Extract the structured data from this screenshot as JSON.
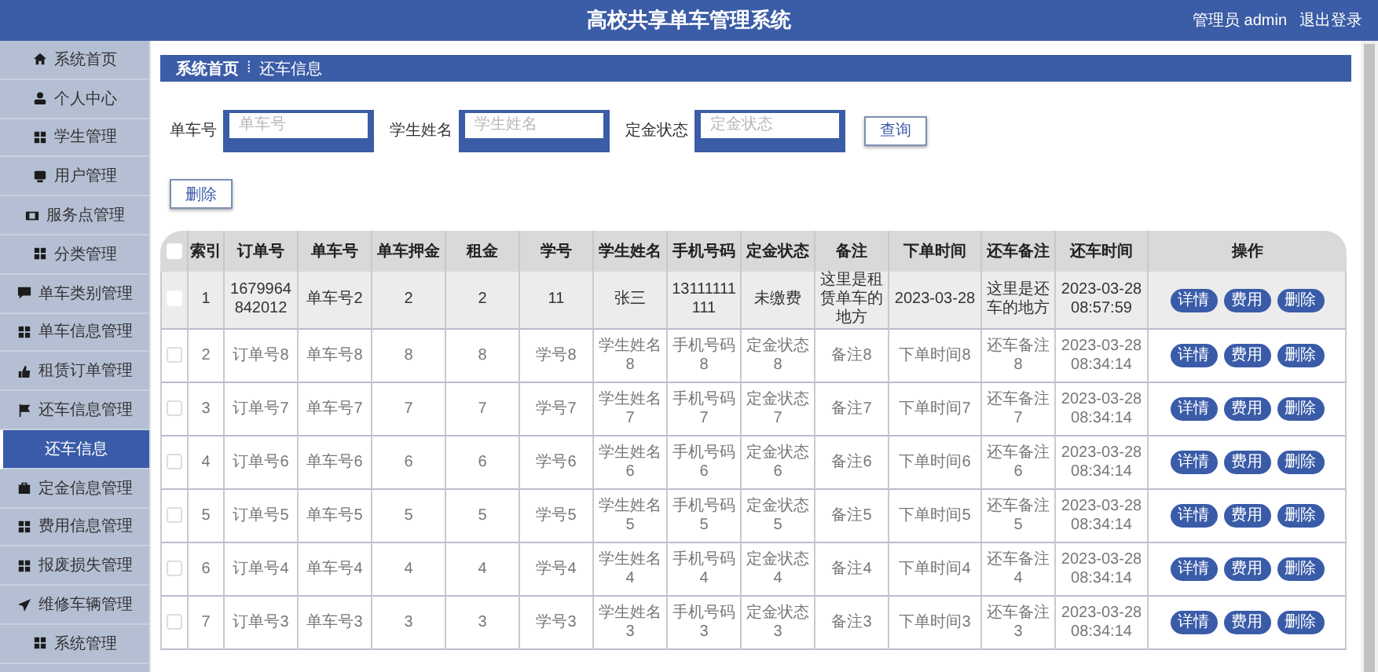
{
  "header": {
    "title": "高校共享单车管理系统",
    "user": "管理员 admin",
    "logout": "退出登录"
  },
  "sidebar": {
    "items": [
      {
        "label": "系统首页",
        "kind": "home",
        "selected": false
      },
      {
        "label": "个人中心",
        "kind": "user",
        "selected": false
      },
      {
        "label": "学生管理",
        "kind": "grid",
        "selected": false
      },
      {
        "label": "用户管理",
        "kind": "monitor",
        "selected": false
      },
      {
        "label": "服务点管理",
        "kind": "film",
        "selected": false
      },
      {
        "label": "分类管理",
        "kind": "grid",
        "selected": false
      },
      {
        "label": "单车类别管理",
        "kind": "chat",
        "selected": false
      },
      {
        "label": "单车信息管理",
        "kind": "grid",
        "selected": false
      },
      {
        "label": "租赁订单管理",
        "kind": "thumb",
        "selected": false
      },
      {
        "label": "还车信息管理",
        "kind": "flag",
        "selected": false
      },
      {
        "label": "还车信息",
        "kind": "sub",
        "selected": true
      },
      {
        "label": "定金信息管理",
        "kind": "bag",
        "selected": false
      },
      {
        "label": "费用信息管理",
        "kind": "grid",
        "selected": false
      },
      {
        "label": "报废损失管理",
        "kind": "grid",
        "selected": false
      },
      {
        "label": "维修车辆管理",
        "kind": "plane",
        "selected": false
      },
      {
        "label": "系统管理",
        "kind": "grid",
        "selected": false
      }
    ]
  },
  "breadcrumb": {
    "home": "系统首页",
    "separator": "⁞",
    "current": "还车信息"
  },
  "search": {
    "fields": [
      {
        "label": "单车号",
        "placeholder": "单车号"
      },
      {
        "label": "学生姓名",
        "placeholder": "学生姓名"
      },
      {
        "label": "定金状态",
        "placeholder": "定金状态"
      }
    ],
    "button": "查询"
  },
  "delete_button": "删除",
  "table": {
    "select_all_checked": false,
    "columns": [
      "索引",
      "订单号",
      "单车号",
      "单车押金",
      "租金",
      "学号",
      "学生姓名",
      "手机号码",
      "定金状态",
      "备注",
      "下单时间",
      "还车备注",
      "还车时间",
      "操作"
    ],
    "rows": [
      {
        "checked": false,
        "highlighted": true,
        "cells": [
          "1",
          "1679964842012",
          "单车号2",
          "2",
          "2",
          "11",
          "张三",
          "13111111111",
          "未缴费",
          "这里是租赁单车的地方",
          "2023-03-28",
          "这里是还车的地方",
          "2023-03-28 08:57:59"
        ],
        "actions": [
          "详情",
          "费用",
          "删除"
        ]
      },
      {
        "checked": false,
        "highlighted": false,
        "cells": [
          "2",
          "订单号8",
          "单车号8",
          "8",
          "8",
          "学号8",
          "学生姓名8",
          "手机号码8",
          "定金状态8",
          "备注8",
          "下单时间8",
          "还车备注8",
          "2023-03-28 08:34:14"
        ],
        "actions": [
          "详情",
          "费用",
          "删除"
        ]
      },
      {
        "checked": false,
        "highlighted": false,
        "cells": [
          "3",
          "订单号7",
          "单车号7",
          "7",
          "7",
          "学号7",
          "学生姓名7",
          "手机号码7",
          "定金状态7",
          "备注7",
          "下单时间7",
          "还车备注7",
          "2023-03-28 08:34:14"
        ],
        "actions": [
          "详情",
          "费用",
          "删除"
        ]
      },
      {
        "checked": false,
        "highlighted": false,
        "cells": [
          "4",
          "订单号6",
          "单车号6",
          "6",
          "6",
          "学号6",
          "学生姓名6",
          "手机号码6",
          "定金状态6",
          "备注6",
          "下单时间6",
          "还车备注6",
          "2023-03-28 08:34:14"
        ],
        "actions": [
          "详情",
          "费用",
          "删除"
        ]
      },
      {
        "checked": false,
        "highlighted": false,
        "cells": [
          "5",
          "订单号5",
          "单车号5",
          "5",
          "5",
          "学号5",
          "学生姓名5",
          "手机号码5",
          "定金状态5",
          "备注5",
          "下单时间5",
          "还车备注5",
          "2023-03-28 08:34:14"
        ],
        "actions": [
          "详情",
          "费用",
          "删除"
        ]
      },
      {
        "checked": false,
        "highlighted": false,
        "cells": [
          "6",
          "订单号4",
          "单车号4",
          "4",
          "4",
          "学号4",
          "学生姓名4",
          "手机号码4",
          "定金状态4",
          "备注4",
          "下单时间4",
          "还车备注4",
          "2023-03-28 08:34:14"
        ],
        "actions": [
          "详情",
          "费用",
          "删除"
        ]
      },
      {
        "checked": false,
        "highlighted": false,
        "cells": [
          "7",
          "订单号3",
          "单车号3",
          "3",
          "3",
          "学号3",
          "学生姓名3",
          "手机号码3",
          "定金状态3",
          "备注3",
          "下单时间3",
          "还车备注3",
          "2023-03-28 08:34:14"
        ],
        "actions": [
          "详情",
          "费用",
          "删除"
        ]
      }
    ]
  }
}
